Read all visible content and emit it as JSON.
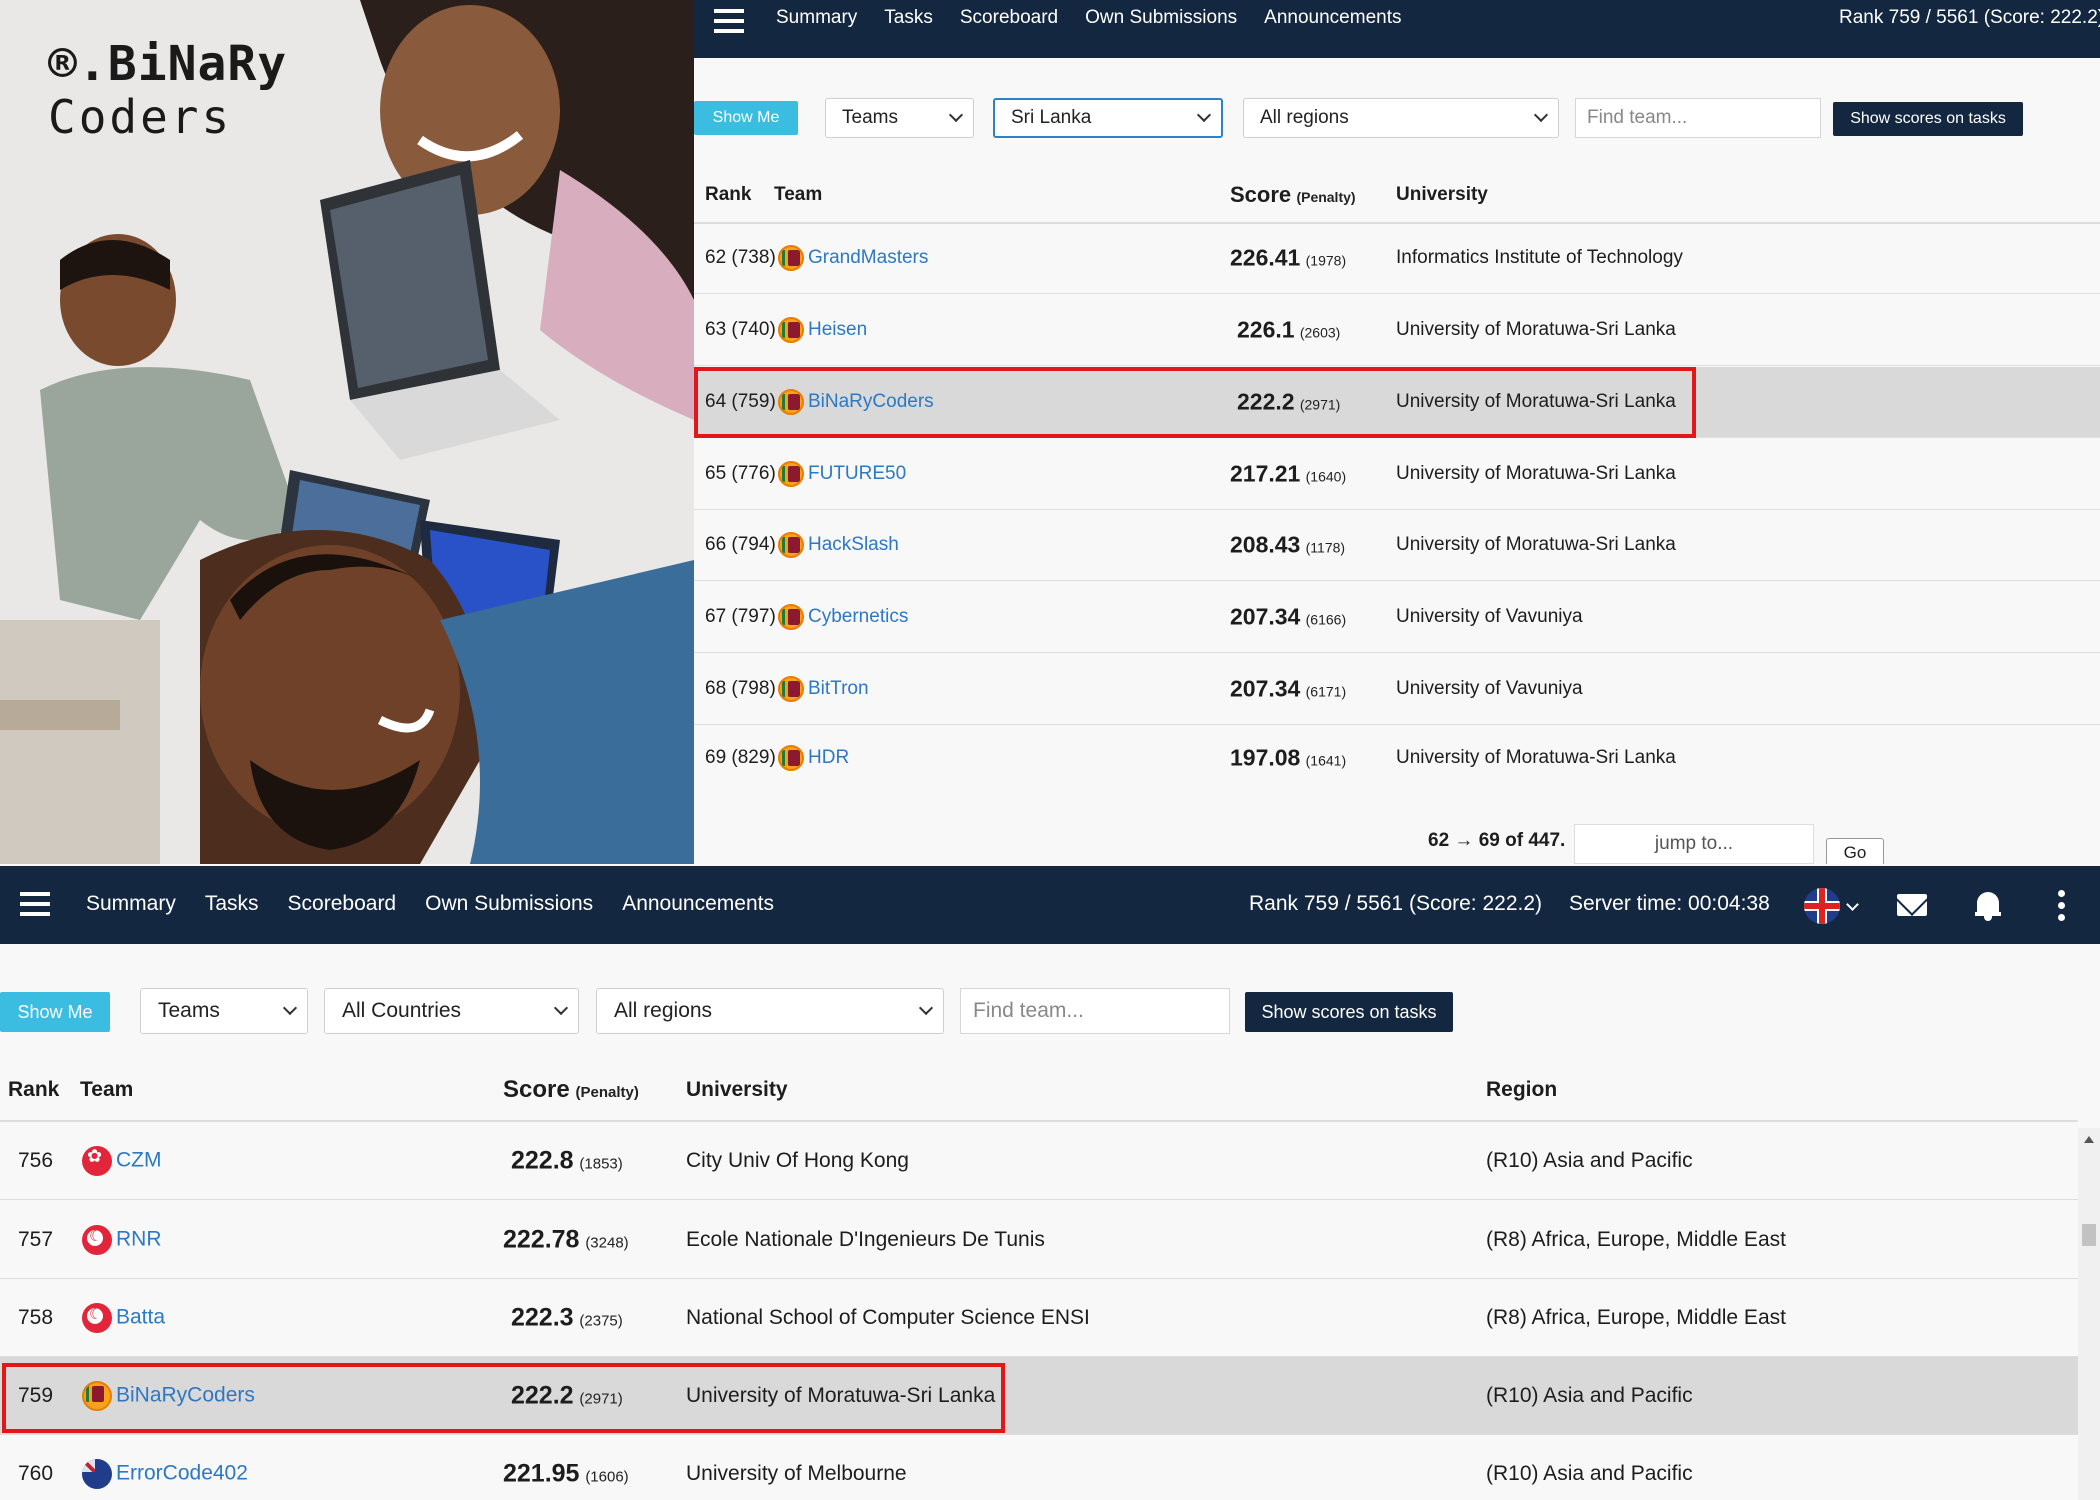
{
  "logo": {
    "line1": "®.BiNaRy",
    "line2": "Coders"
  },
  "nav": {
    "items": [
      "Summary",
      "Tasks",
      "Scoreboard",
      "Own Submissions",
      "Announcements"
    ]
  },
  "top": {
    "rank_text": "Rank 759 / 5561 (Score: 222.2)",
    "filters": {
      "show_me": "Show Me",
      "type": "Teams",
      "country": "Sri Lanka",
      "region": "All regions",
      "find_placeholder": "Find team...",
      "show_scores": "Show scores on tasks"
    },
    "headers": {
      "rank": "Rank",
      "team": "Team",
      "score": "Score",
      "penalty": "(Penalty)",
      "university": "University"
    },
    "rows": [
      {
        "rank": "62 (738)",
        "team": "GrandMasters",
        "score": "226.41",
        "penalty": "(1978)",
        "university": "Informatics Institute of Technology"
      },
      {
        "rank": "63 (740)",
        "team": "Heisen",
        "score": "226.1",
        "penalty": "(2603)",
        "university": "University of Moratuwa-Sri Lanka"
      },
      {
        "rank": "64 (759)",
        "team": "BiNaRyCoders",
        "score": "222.2",
        "penalty": "(2971)",
        "university": "University of Moratuwa-Sri Lanka"
      },
      {
        "rank": "65 (776)",
        "team": "FUTURE50",
        "score": "217.21",
        "penalty": "(1640)",
        "university": "University of Moratuwa-Sri Lanka"
      },
      {
        "rank": "66 (794)",
        "team": "HackSlash",
        "score": "208.43",
        "penalty": "(1178)",
        "university": "University of Moratuwa-Sri Lanka"
      },
      {
        "rank": "67 (797)",
        "team": "Cybernetics",
        "score": "207.34",
        "penalty": "(6166)",
        "university": "University of Vavuniya"
      },
      {
        "rank": "68 (798)",
        "team": "BitTron",
        "score": "207.34",
        "penalty": "(6171)",
        "university": "University of Vavuniya"
      },
      {
        "rank": "69 (829)",
        "team": "HDR",
        "score": "197.08",
        "penalty": "(1641)",
        "university": "University of Moratuwa-Sri Lanka"
      }
    ],
    "pager": {
      "text": "62 → 69 of 447.",
      "jump_placeholder": "jump to...",
      "go": "Go"
    }
  },
  "bottom": {
    "rank_text": "Rank 759 / 5561 (Score: 222.2)",
    "server_time": "Server time: 00:04:38",
    "filters": {
      "show_me": "Show Me",
      "type": "Teams",
      "country": "All Countries",
      "region": "All regions",
      "find_placeholder": "Find team...",
      "show_scores": "Show scores on tasks"
    },
    "headers": {
      "rank": "Rank",
      "team": "Team",
      "score": "Score",
      "penalty": "(Penalty)",
      "university": "University",
      "region": "Region"
    },
    "rows": [
      {
        "rank": "756",
        "team": "CZM",
        "flag": "hong-kong-flag-icon",
        "score": "222.8",
        "penalty": "(1853)",
        "university": "City Univ Of Hong Kong",
        "region": "(R10) Asia and Pacific"
      },
      {
        "rank": "757",
        "team": "RNR",
        "flag": "tunisia-flag-icon",
        "score": "222.78",
        "penalty": "(3248)",
        "university": "Ecole Nationale D'Ingenieurs De Tunis",
        "region": "(R8) Africa, Europe, Middle East"
      },
      {
        "rank": "758",
        "team": "Batta",
        "flag": "tunisia-flag-icon",
        "score": "222.3",
        "penalty": "(2375)",
        "university": "National School of Computer Science ENSI",
        "region": "(R8) Africa, Europe, Middle East"
      },
      {
        "rank": "759",
        "team": "BiNaRyCoders",
        "flag": "sri-lanka-flag-icon",
        "score": "222.2",
        "penalty": "(2971)",
        "university": "University of Moratuwa-Sri Lanka",
        "region": "(R10) Asia and Pacific"
      },
      {
        "rank": "760",
        "team": "ErrorCode402",
        "flag": "australia-flag-icon",
        "score": "221.95",
        "penalty": "(1606)",
        "university": "University of Melbourne",
        "region": "(R10) Asia and Pacific"
      }
    ]
  },
  "colors": {
    "navbar": "#132840",
    "show_me": "#3bbde1",
    "team_link": "#2d78c4",
    "highlight_row": "#d9d9d9",
    "annotation_box": "#e0171b"
  }
}
